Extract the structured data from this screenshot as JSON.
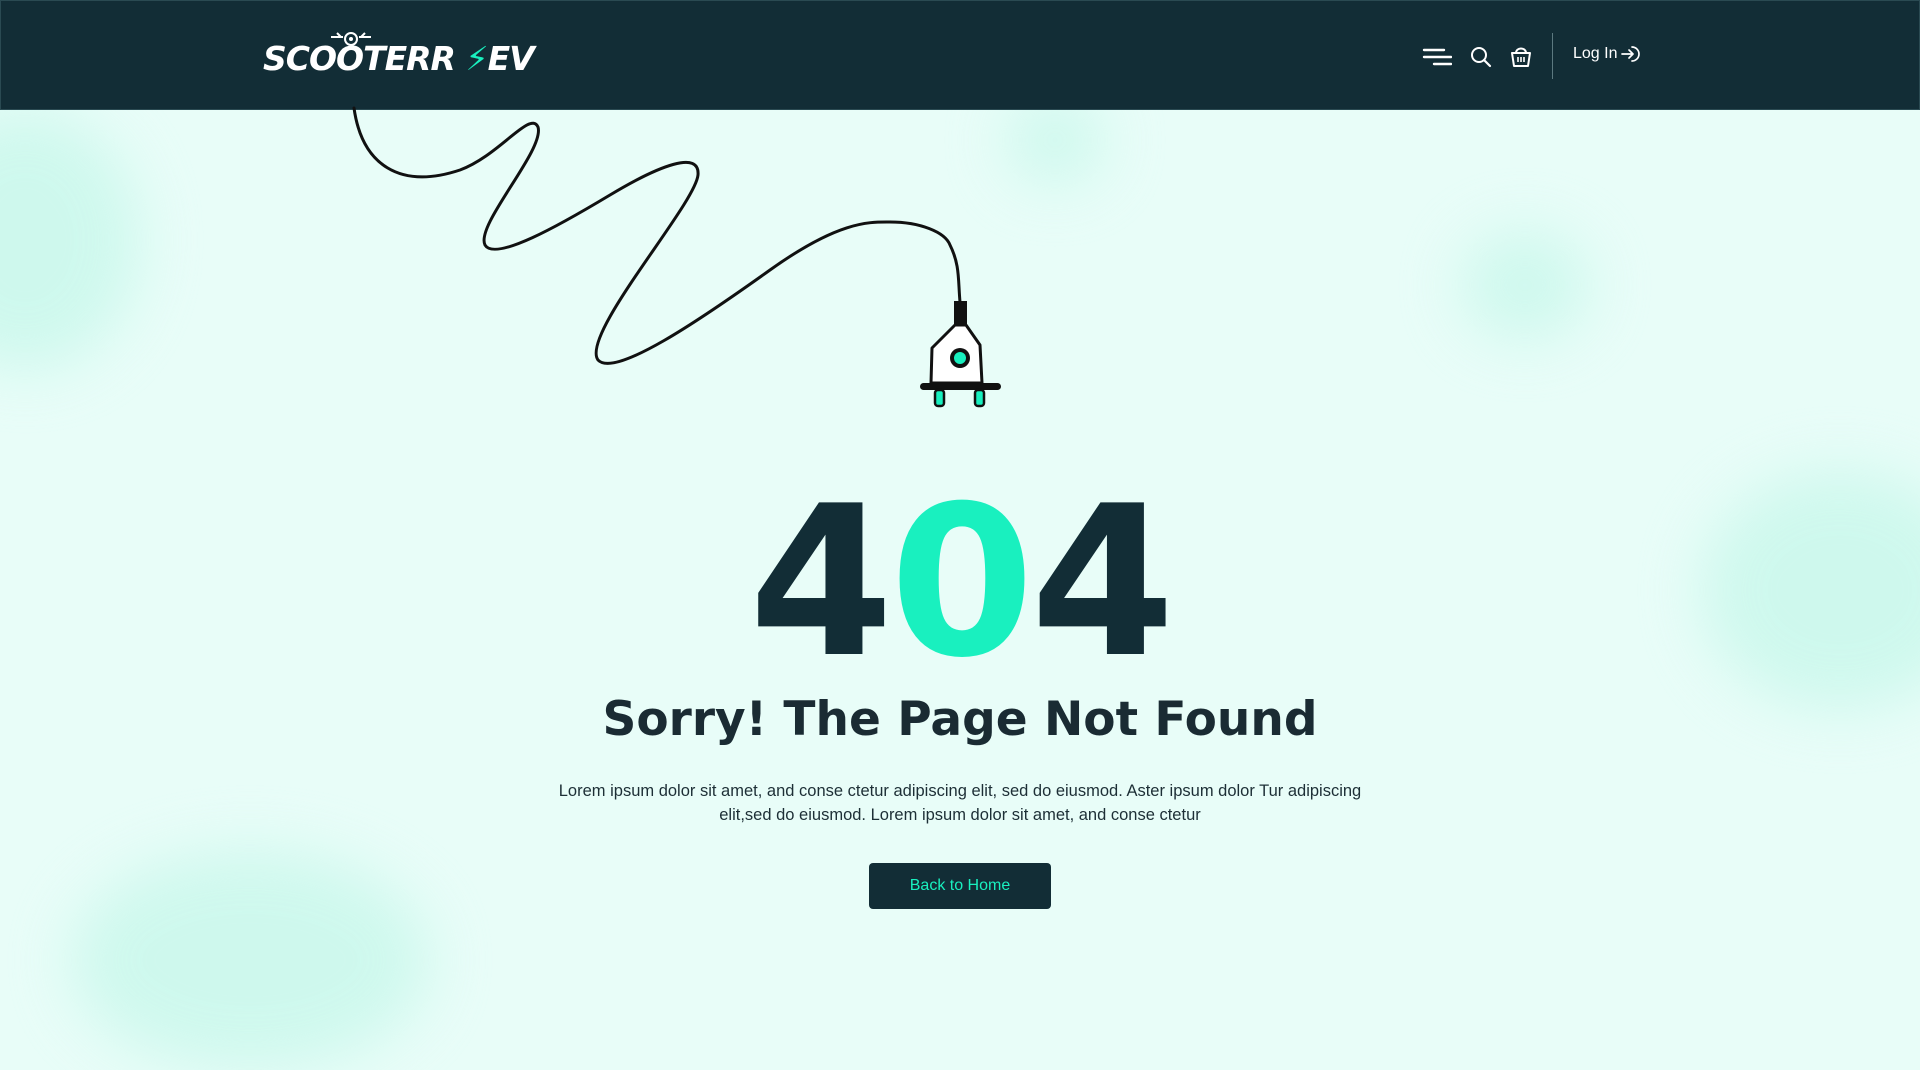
{
  "header": {
    "logo": {
      "text": "SCOOTERR",
      "suffix": "EV"
    },
    "icons": [
      "menu-icon",
      "search-icon",
      "cart-icon"
    ],
    "login_label": "Log In"
  },
  "main": {
    "code_digits": [
      "4",
      "0",
      "4"
    ],
    "title": "Sorry! The Page Not Found",
    "description": "Lorem ipsum dolor sit amet, and conse ctetur adipiscing elit, sed do eiusmod. Aster ipsum dolor Tur adipiscing elit,sed do eiusmod. Lorem ipsum dolor sit amet, and conse ctetur",
    "button_label": "Back to Home"
  },
  "colors": {
    "header_bg": "#122d36",
    "page_bg": "#e8fdf8",
    "accent": "#19f0bf",
    "dark_text": "#1a2b33"
  }
}
